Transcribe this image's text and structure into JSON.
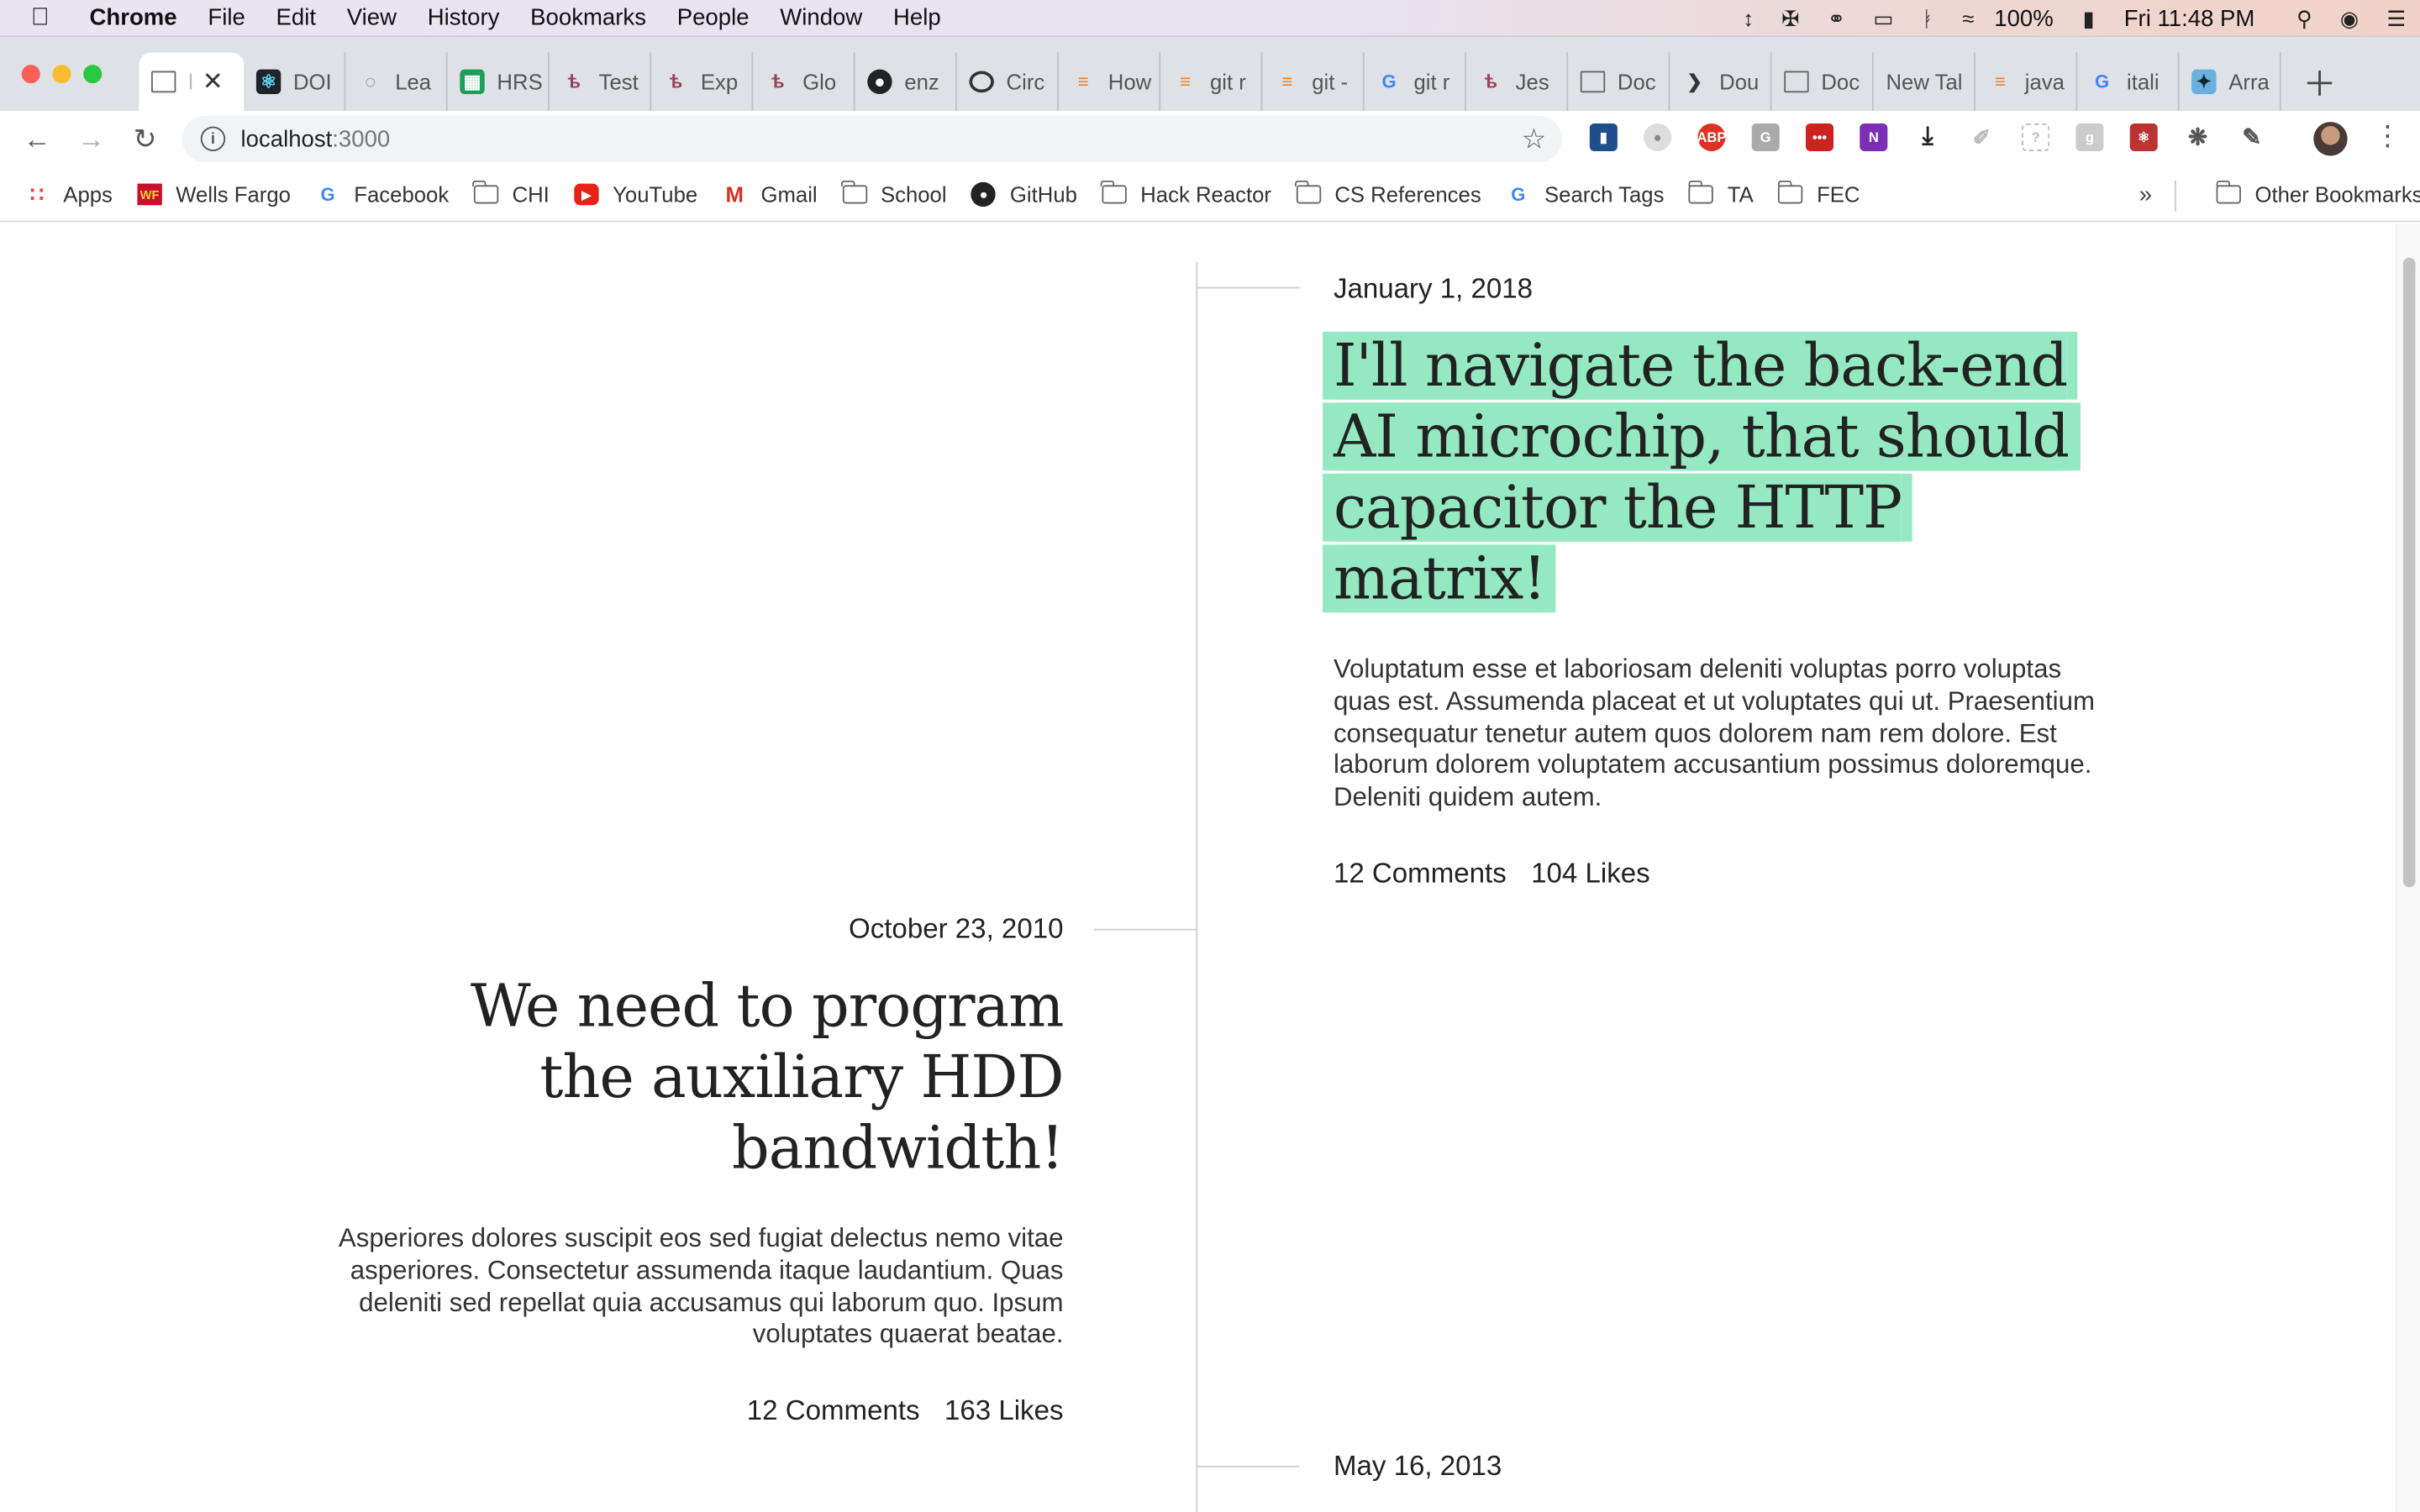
{
  "menubar": {
    "app_name": "Chrome",
    "menus": [
      "File",
      "Edit",
      "View",
      "History",
      "Bookmarks",
      "People",
      "Window",
      "Help"
    ],
    "battery": "100%",
    "clock": "Fri 11:48 PM"
  },
  "tabs": [
    {
      "label": "l",
      "icon": "document-icon",
      "active": true
    },
    {
      "label": "DOI",
      "icon": "react-icon"
    },
    {
      "label": "Lea",
      "icon": "spinner-icon"
    },
    {
      "label": "HRS",
      "icon": "sheets-icon"
    },
    {
      "label": "Test",
      "icon": "jest-icon"
    },
    {
      "label": "Exp",
      "icon": "jest-icon"
    },
    {
      "label": "Glo",
      "icon": "jest-icon"
    },
    {
      "label": "enz",
      "icon": "github-icon"
    },
    {
      "label": "Circ",
      "icon": "circleci-icon"
    },
    {
      "label": "How",
      "icon": "stackoverflow-icon"
    },
    {
      "label": "git r",
      "icon": "stackoverflow-icon"
    },
    {
      "label": "git -",
      "icon": "stackoverflow-icon"
    },
    {
      "label": "git r",
      "icon": "google-icon"
    },
    {
      "label": "Jes",
      "icon": "jest-icon"
    },
    {
      "label": "Doc",
      "icon": "document-icon"
    },
    {
      "label": "Dou",
      "icon": "arrow-icon"
    },
    {
      "label": "Doc",
      "icon": "document-icon"
    },
    {
      "label": "New Tal",
      "icon": ""
    },
    {
      "label": "java",
      "icon": "stackoverflow-icon"
    },
    {
      "label": "itali",
      "icon": "google-icon"
    },
    {
      "label": "Arra",
      "icon": "bird-icon"
    }
  ],
  "address_bar": {
    "host": "localhost",
    "port": ":3000"
  },
  "bookmarks": [
    {
      "label": "Apps",
      "icon": "apps-grid-icon"
    },
    {
      "label": "Wells Fargo",
      "icon": "wellsfargo-icon"
    },
    {
      "label": "Facebook",
      "icon": "google-icon"
    },
    {
      "label": "CHI",
      "icon": "folder-icon"
    },
    {
      "label": "YouTube",
      "icon": "youtube-icon"
    },
    {
      "label": "Gmail",
      "icon": "gmail-icon"
    },
    {
      "label": "School",
      "icon": "folder-icon"
    },
    {
      "label": "GitHub",
      "icon": "github-icon"
    },
    {
      "label": "Hack Reactor",
      "icon": "folder-icon"
    },
    {
      "label": "CS References",
      "icon": "folder-icon"
    },
    {
      "label": "Search Tags",
      "icon": "google-icon"
    },
    {
      "label": "TA",
      "icon": "folder-icon"
    },
    {
      "label": "FEC",
      "icon": "folder-icon"
    }
  ],
  "bookmarks_more": "»",
  "other_bookmarks": "Other Bookmarks",
  "posts": [
    {
      "date": "January 1, 2018",
      "title": "I'll navigate the back-end AI microchip, that should capacitor the HTTP matrix!",
      "body": "Voluptatum esse et laboriosam deleniti voluptas porro voluptas quas est. Assumenda placeat et ut voluptates qui ut. Praesentium consequatur tenetur autem quos dolorem nam rem dolore. Est laborum dolorem voluptatem accusantium possimus doloremque. Deleniti quidem autem.",
      "comments": "12 Comments",
      "likes": "104 Likes",
      "highlighted": true
    },
    {
      "date": "October 23, 2010",
      "title": "We need to program the auxiliary HDD bandwidth!",
      "body": "Asperiores dolores suscipit eos sed fugiat delectus nemo vitae asperiores. Consectetur assumenda itaque laudantium. Quas deleniti sed repellat quia accusamus qui laborum quo. Ipsum voluptates quaerat beatae.",
      "comments": "12 Comments",
      "likes": "163 Likes"
    },
    {
      "date": "May 16, 2013"
    }
  ],
  "colors": {
    "highlight": "#95e9c2",
    "timeline_line": "#cccccc"
  }
}
